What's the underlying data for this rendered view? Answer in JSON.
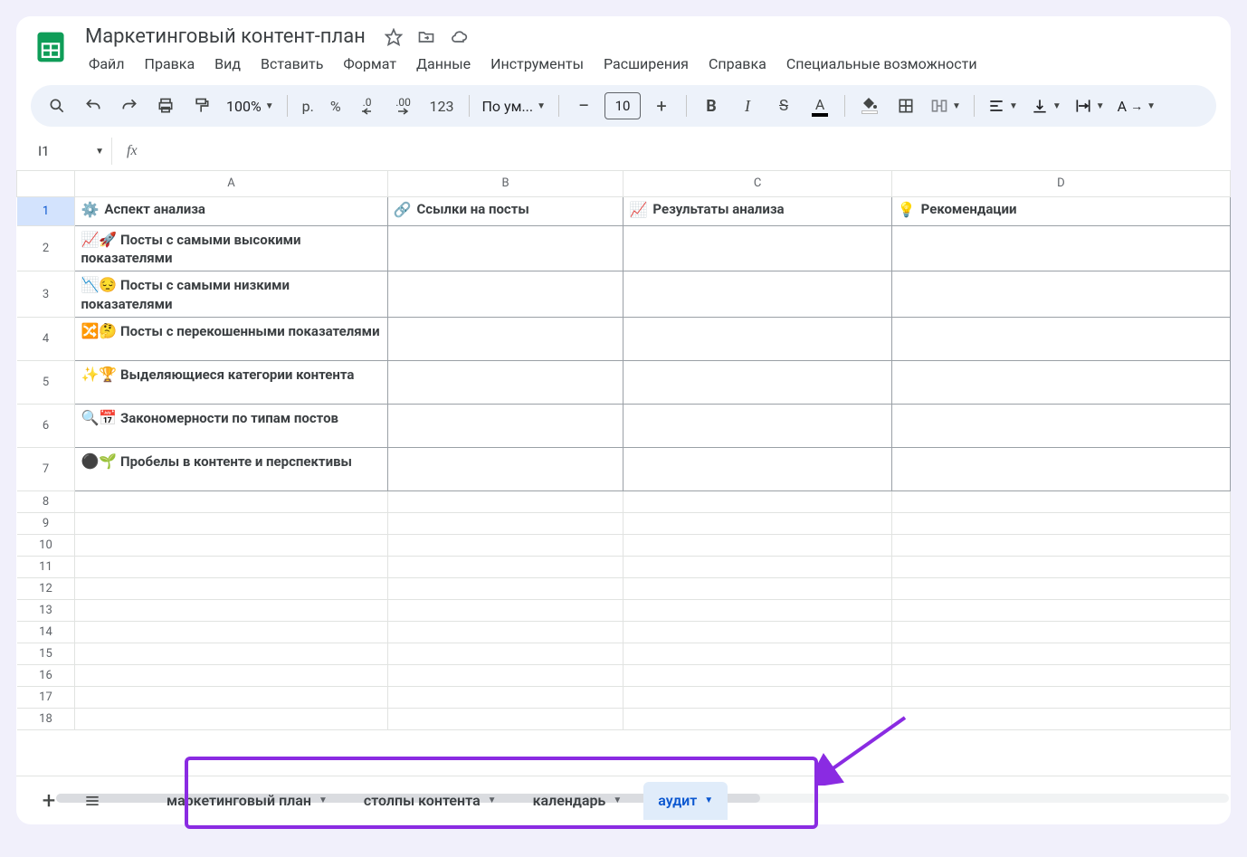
{
  "doc": {
    "title": "Маркетинговый контент-план"
  },
  "menus": {
    "file": "Файл",
    "edit": "Правка",
    "view": "Вид",
    "insert": "Вставить",
    "format": "Формат",
    "data": "Данные",
    "tools": "Инструменты",
    "extensions": "Расширения",
    "help": "Справка",
    "accessibility": "Специальные возможности"
  },
  "toolbar": {
    "zoom": "100%",
    "currency_symbol": "р.",
    "percent": "%",
    "decimal_dec": ".0",
    "decimal_inc": ".00",
    "format_123": "123",
    "font": "По ум...",
    "font_size": "10"
  },
  "formula": {
    "name_box": "I1",
    "fx": "fx",
    "value": ""
  },
  "columns": {
    "A": "A",
    "B": "B",
    "C": "C",
    "D": "D"
  },
  "headers": {
    "a": "Аспект анализа",
    "b": "Ссылки на посты",
    "c": "Результаты анализа",
    "d": "Рекомендации",
    "a_icon": "⚙️",
    "b_icon": "🔗",
    "c_icon": "📈",
    "d_icon": "💡"
  },
  "rows": [
    {
      "n": "1"
    },
    {
      "n": "2",
      "a_icons": "📈🚀",
      "a_text": "Посты с самыми высокими показателями"
    },
    {
      "n": "3",
      "a_icons": "📉😔",
      "a_text": "Посты с самыми низкими показателями"
    },
    {
      "n": "4",
      "a_icons": "🔀🤔",
      "a_text": "Посты с перекошенными показателями"
    },
    {
      "n": "5",
      "a_icons": "✨🏆",
      "a_text": "Выделяющиеся категории контента"
    },
    {
      "n": "6",
      "a_icons": "🔍📅",
      "a_text": "Закономерности по типам постов"
    },
    {
      "n": "7",
      "a_icons": "⚫🌱",
      "a_text": "Пробелы в контенте и перспективы"
    },
    {
      "n": "8"
    },
    {
      "n": "9"
    },
    {
      "n": "10"
    },
    {
      "n": "11"
    },
    {
      "n": "12"
    },
    {
      "n": "13"
    },
    {
      "n": "14"
    },
    {
      "n": "15"
    },
    {
      "n": "16"
    },
    {
      "n": "17"
    },
    {
      "n": "18"
    }
  ],
  "tabs": {
    "t1": "маркетинговый план",
    "t2": "столпы контента",
    "t3": "календарь",
    "t4": "аудит"
  }
}
